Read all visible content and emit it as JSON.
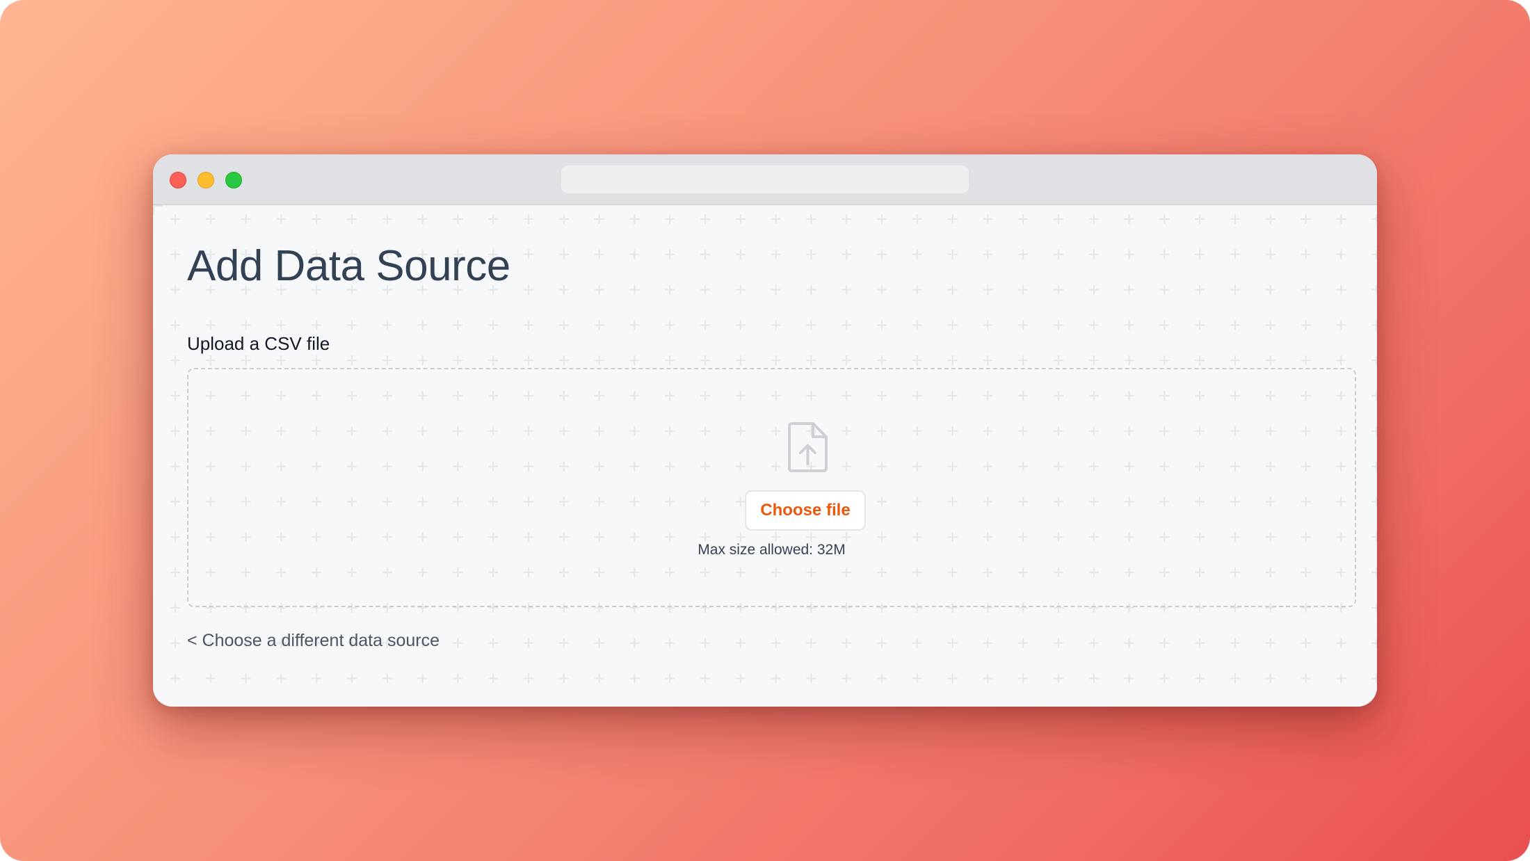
{
  "page": {
    "title": "Add Data Source",
    "upload_label": "Upload a CSV file",
    "choose_file_label": "Choose file",
    "max_size_text": "Max size allowed: 32M",
    "back_link_label": "< Choose a different data source"
  },
  "icons": {
    "upload": "file-upload-icon"
  },
  "colors": {
    "accent": "#ea580c",
    "title": "#334155",
    "traffic_red": "#fe5f57",
    "traffic_yellow": "#febc2e",
    "traffic_green": "#28c840"
  }
}
